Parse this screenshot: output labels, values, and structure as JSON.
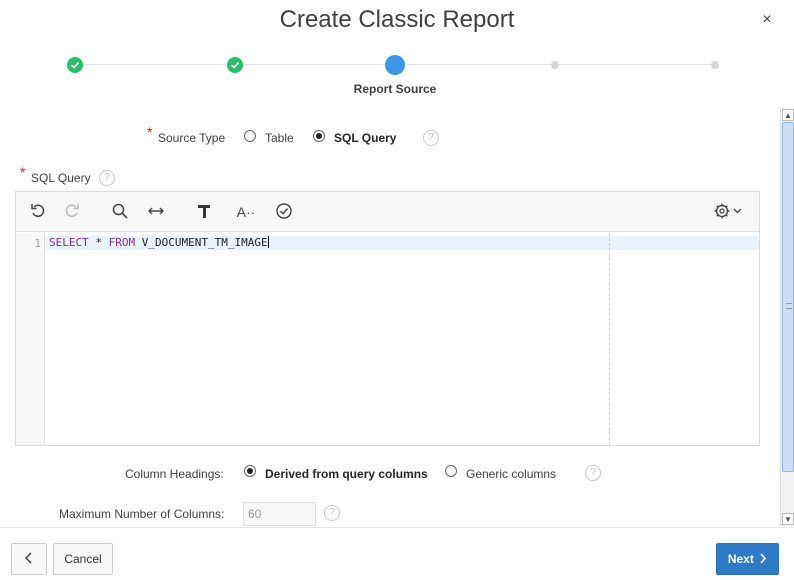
{
  "dialog": {
    "title": "Create Classic Report",
    "close_glyph": "×"
  },
  "wizard": {
    "current_label": "Report Source"
  },
  "source_type": {
    "label": "Source Type",
    "options": [
      "Table",
      "SQL Query"
    ],
    "selected": "SQL Query"
  },
  "sql_query": {
    "label": "SQL Query",
    "line_number": "1",
    "code_tokens": [
      "SELECT",
      " * ",
      "FROM",
      " V_DOCUMENT_TM_IMAGE"
    ]
  },
  "editor_toolbar": {
    "icons": [
      "undo-icon",
      "redo-icon",
      "search-icon",
      "expand-width-icon",
      "hammer-icon",
      "text-style-icon",
      "validate-icon",
      "gear-icon"
    ]
  },
  "column_headings": {
    "label": "Column Headings:",
    "options": [
      "Derived from query columns",
      "Generic columns"
    ],
    "selected": "Derived from query columns"
  },
  "max_columns": {
    "label": "Maximum Number of Columns:",
    "placeholder": "60"
  },
  "footer": {
    "back_glyph": "‹",
    "cancel_label": "Cancel",
    "next_label": "Next",
    "next_glyph": "›"
  },
  "colors": {
    "step_done": "#2bbf6a",
    "step_current": "#3b97e3",
    "primary_button": "#2f7ac7",
    "required": "#d21d1d",
    "keyword": "#7a2e8f"
  }
}
